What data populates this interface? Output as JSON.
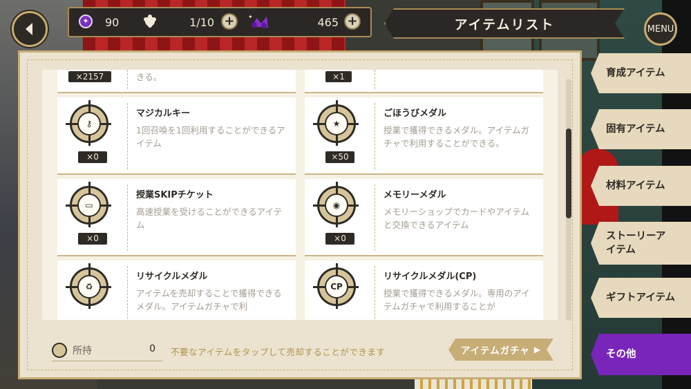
{
  "header": {
    "gems": "90",
    "stamina": "1/10",
    "madol": "465",
    "title": "アイテムリスト",
    "menu_label": "MENU"
  },
  "items": [
    {
      "name": "",
      "count": "×2157",
      "desc": "きる。"
    },
    {
      "name": "",
      "count": "×1",
      "desc": ""
    },
    {
      "name": "マジカルキー",
      "count": "×0",
      "desc": "1回召喚を1回利用することができるアイテム",
      "icon": "key-icon"
    },
    {
      "name": "ごほうびメダル",
      "count": "×50",
      "desc": "授業で獲得できるメダル。アイテムガチャで利用することができる。",
      "icon": "reward-medal-icon"
    },
    {
      "name": "授業SKIPチケット",
      "count": "×0",
      "desc": "高速授業を受けることができるアイテム",
      "icon": "ticket-icon"
    },
    {
      "name": "メモリーメダル",
      "count": "×0",
      "desc": "メモリーショップでカードやアイテムと交換できるアイテム",
      "icon": "memory-medal-icon"
    },
    {
      "name": "リサイクルメダル",
      "count": "",
      "desc": "アイテムを売却することで獲得できるメダル。アイテムガチャで利",
      "icon": "recycle-medal-icon"
    },
    {
      "name": "リサイクルメダル(CP)",
      "count": "",
      "desc": "授業で獲得できるメダル。専用のアイテムガチャで利用することが",
      "icon": "recycle-medal-cp-icon",
      "badge": "CP"
    }
  ],
  "footer": {
    "owned_label": "所持",
    "owned_value": "0",
    "hint": "不要なアイテムをタップして売却することができます",
    "gacha_label": "アイテムガチャ"
  },
  "tabs": [
    {
      "label": "育成アイテム",
      "active": false
    },
    {
      "label": "固有アイテム",
      "active": false
    },
    {
      "label": "材料アイテム",
      "active": false
    },
    {
      "label": "ストーリーアイテム",
      "active": false
    },
    {
      "label": "ギフトアイテム",
      "active": false
    },
    {
      "label": "その他",
      "active": true
    }
  ],
  "colors": {
    "accent_purple": "#7a25b9",
    "gold": "#c7ad76",
    "dark": "#2e2a25"
  }
}
